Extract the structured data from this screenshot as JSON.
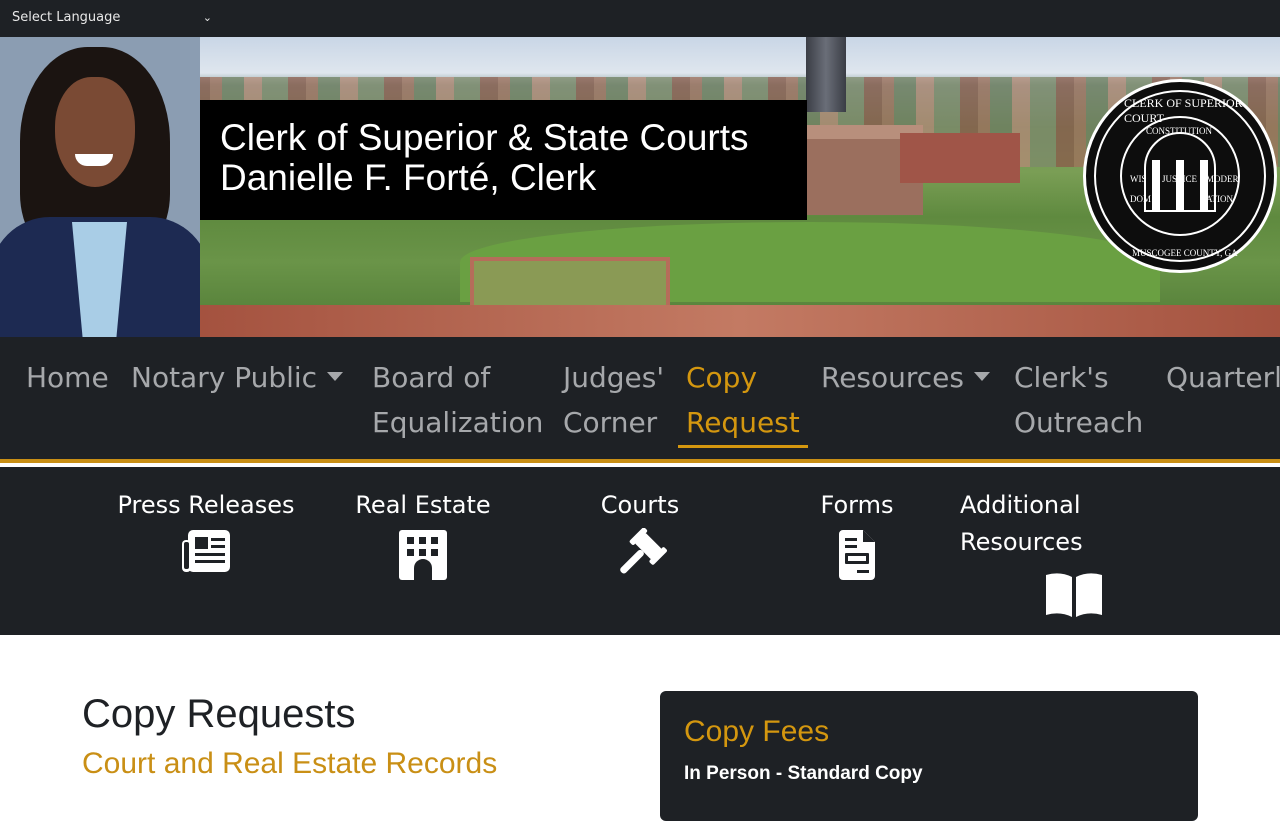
{
  "topbar": {
    "language_select": "Select Language"
  },
  "hero": {
    "title_line1": "Clerk of Superior & State Courts",
    "title_line2": "Danielle F. Forté, Clerk",
    "seal_text_top": "CLERK OF SUPERIOR COURT",
    "seal_text_bottom": "MUSCOGEE COUNTY, GA",
    "seal_words": [
      "CONSTITUTION",
      "WIS",
      "JUSTICE",
      "MODER",
      "DOM",
      "ATION"
    ]
  },
  "nav": {
    "items": [
      {
        "label": "Home"
      },
      {
        "label": "Notary Public",
        "dropdown": true
      },
      {
        "label_line1": "Board of",
        "label_line2": "Equalization"
      },
      {
        "label_line1": "Judges'",
        "label_line2": "Corner"
      },
      {
        "label_line1": "Copy",
        "label_line2": "Request",
        "active": true
      },
      {
        "label": "Resources",
        "dropdown": true
      },
      {
        "label_line1": "Clerk's",
        "label_line2": "Outreach"
      },
      {
        "label": "Quarterl"
      }
    ]
  },
  "quick_links": [
    {
      "label": "Press Releases",
      "icon": "newspaper-icon"
    },
    {
      "label": "Real Estate",
      "icon": "building-icon"
    },
    {
      "label": "Courts",
      "icon": "gavel-icon"
    },
    {
      "label": "Forms",
      "icon": "file-invoice-icon"
    },
    {
      "label_line1": "Additional",
      "label_line2": "Resources",
      "icon": "book-open-icon"
    }
  ],
  "main": {
    "heading": "Copy Requests",
    "subheading": "Court and Real Estate Records"
  },
  "fees": {
    "title": "Copy Fees",
    "subtitle": "In Person - Standard Copy"
  },
  "colors": {
    "dark": "#1e2125",
    "accent": "#d4970f",
    "nav_text": "#a6a8ab"
  }
}
